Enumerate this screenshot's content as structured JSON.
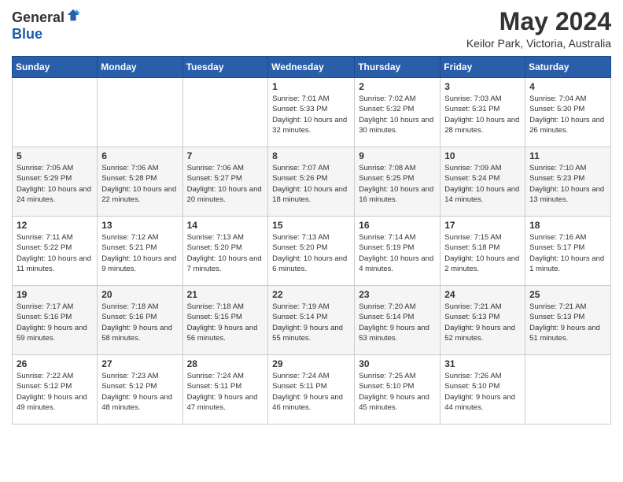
{
  "header": {
    "logo_general": "General",
    "logo_blue": "Blue",
    "month_title": "May 2024",
    "location": "Keilor Park, Victoria, Australia"
  },
  "days_of_week": [
    "Sunday",
    "Monday",
    "Tuesday",
    "Wednesday",
    "Thursday",
    "Friday",
    "Saturday"
  ],
  "weeks": [
    [
      {
        "day": "",
        "info": ""
      },
      {
        "day": "",
        "info": ""
      },
      {
        "day": "",
        "info": ""
      },
      {
        "day": "1",
        "sunrise": "7:01 AM",
        "sunset": "5:33 PM",
        "daylight": "10 hours and 32 minutes."
      },
      {
        "day": "2",
        "sunrise": "7:02 AM",
        "sunset": "5:32 PM",
        "daylight": "10 hours and 30 minutes."
      },
      {
        "day": "3",
        "sunrise": "7:03 AM",
        "sunset": "5:31 PM",
        "daylight": "10 hours and 28 minutes."
      },
      {
        "day": "4",
        "sunrise": "7:04 AM",
        "sunset": "5:30 PM",
        "daylight": "10 hours and 26 minutes."
      }
    ],
    [
      {
        "day": "5",
        "sunrise": "7:05 AM",
        "sunset": "5:29 PM",
        "daylight": "10 hours and 24 minutes."
      },
      {
        "day": "6",
        "sunrise": "7:06 AM",
        "sunset": "5:28 PM",
        "daylight": "10 hours and 22 minutes."
      },
      {
        "day": "7",
        "sunrise": "7:06 AM",
        "sunset": "5:27 PM",
        "daylight": "10 hours and 20 minutes."
      },
      {
        "day": "8",
        "sunrise": "7:07 AM",
        "sunset": "5:26 PM",
        "daylight": "10 hours and 18 minutes."
      },
      {
        "day": "9",
        "sunrise": "7:08 AM",
        "sunset": "5:25 PM",
        "daylight": "10 hours and 16 minutes."
      },
      {
        "day": "10",
        "sunrise": "7:09 AM",
        "sunset": "5:24 PM",
        "daylight": "10 hours and 14 minutes."
      },
      {
        "day": "11",
        "sunrise": "7:10 AM",
        "sunset": "5:23 PM",
        "daylight": "10 hours and 13 minutes."
      }
    ],
    [
      {
        "day": "12",
        "sunrise": "7:11 AM",
        "sunset": "5:22 PM",
        "daylight": "10 hours and 11 minutes."
      },
      {
        "day": "13",
        "sunrise": "7:12 AM",
        "sunset": "5:21 PM",
        "daylight": "10 hours and 9 minutes."
      },
      {
        "day": "14",
        "sunrise": "7:13 AM",
        "sunset": "5:20 PM",
        "daylight": "10 hours and 7 minutes."
      },
      {
        "day": "15",
        "sunrise": "7:13 AM",
        "sunset": "5:20 PM",
        "daylight": "10 hours and 6 minutes."
      },
      {
        "day": "16",
        "sunrise": "7:14 AM",
        "sunset": "5:19 PM",
        "daylight": "10 hours and 4 minutes."
      },
      {
        "day": "17",
        "sunrise": "7:15 AM",
        "sunset": "5:18 PM",
        "daylight": "10 hours and 2 minutes."
      },
      {
        "day": "18",
        "sunrise": "7:16 AM",
        "sunset": "5:17 PM",
        "daylight": "10 hours and 1 minute."
      }
    ],
    [
      {
        "day": "19",
        "sunrise": "7:17 AM",
        "sunset": "5:16 PM",
        "daylight": "9 hours and 59 minutes."
      },
      {
        "day": "20",
        "sunrise": "7:18 AM",
        "sunset": "5:16 PM",
        "daylight": "9 hours and 58 minutes."
      },
      {
        "day": "21",
        "sunrise": "7:18 AM",
        "sunset": "5:15 PM",
        "daylight": "9 hours and 56 minutes."
      },
      {
        "day": "22",
        "sunrise": "7:19 AM",
        "sunset": "5:14 PM",
        "daylight": "9 hours and 55 minutes."
      },
      {
        "day": "23",
        "sunrise": "7:20 AM",
        "sunset": "5:14 PM",
        "daylight": "9 hours and 53 minutes."
      },
      {
        "day": "24",
        "sunrise": "7:21 AM",
        "sunset": "5:13 PM",
        "daylight": "9 hours and 52 minutes."
      },
      {
        "day": "25",
        "sunrise": "7:21 AM",
        "sunset": "5:13 PM",
        "daylight": "9 hours and 51 minutes."
      }
    ],
    [
      {
        "day": "26",
        "sunrise": "7:22 AM",
        "sunset": "5:12 PM",
        "daylight": "9 hours and 49 minutes."
      },
      {
        "day": "27",
        "sunrise": "7:23 AM",
        "sunset": "5:12 PM",
        "daylight": "9 hours and 48 minutes."
      },
      {
        "day": "28",
        "sunrise": "7:24 AM",
        "sunset": "5:11 PM",
        "daylight": "9 hours and 47 minutes."
      },
      {
        "day": "29",
        "sunrise": "7:24 AM",
        "sunset": "5:11 PM",
        "daylight": "9 hours and 46 minutes."
      },
      {
        "day": "30",
        "sunrise": "7:25 AM",
        "sunset": "5:10 PM",
        "daylight": "9 hours and 45 minutes."
      },
      {
        "day": "31",
        "sunrise": "7:26 AM",
        "sunset": "5:10 PM",
        "daylight": "9 hours and 44 minutes."
      },
      {
        "day": "",
        "info": ""
      }
    ]
  ],
  "labels": {
    "sunrise": "Sunrise:",
    "sunset": "Sunset:",
    "daylight": "Daylight:"
  }
}
